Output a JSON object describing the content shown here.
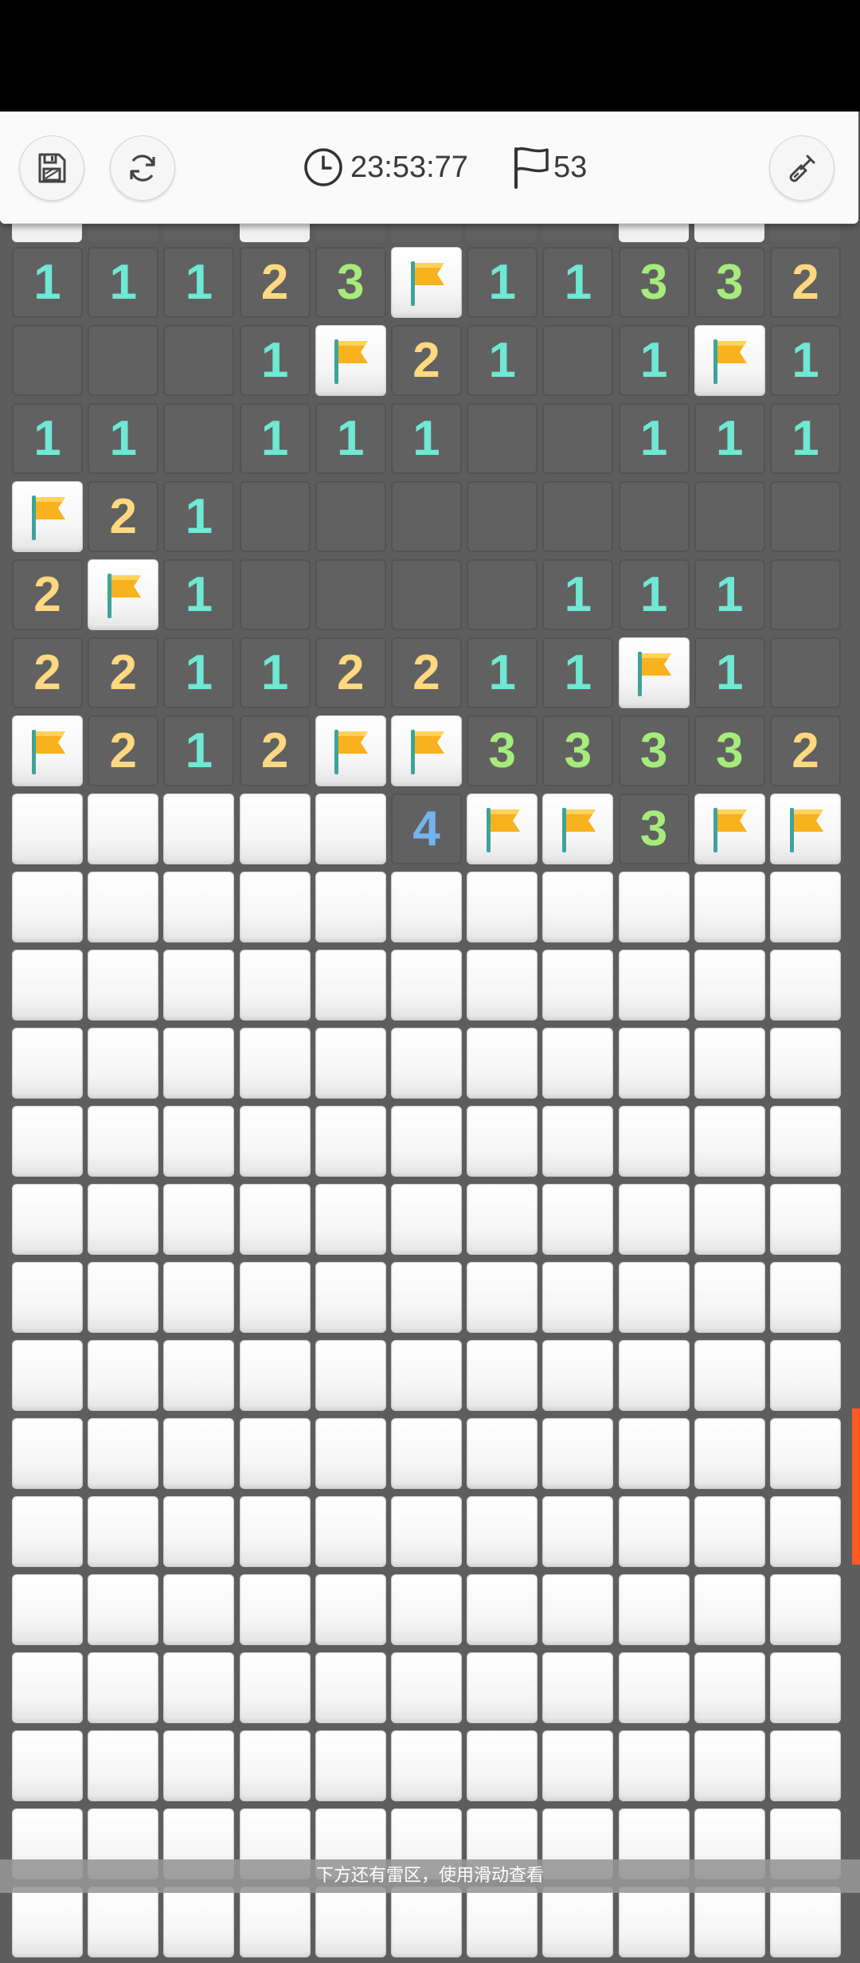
{
  "toolbar": {
    "timer": "23:53:77",
    "flags_remaining": "53",
    "icons": {
      "save": "save-icon",
      "restart": "refresh-icon",
      "timer": "clock-icon",
      "flags": "flag-outline-icon",
      "mode": "shovel-icon"
    }
  },
  "board": {
    "columns": 11,
    "legend": "digits = revealed count, F = flagged, . = revealed empty, # = covered",
    "rows": [
      [
        "1",
        "1",
        "1",
        "2",
        "3",
        "F",
        "1",
        "1",
        "3",
        "3",
        "2"
      ],
      [
        ".",
        ".",
        ".",
        "1",
        "F",
        "2",
        "1",
        ".",
        "1",
        "F",
        "1"
      ],
      [
        "1",
        "1",
        ".",
        "1",
        "1",
        "1",
        ".",
        ".",
        "1",
        "1",
        "1"
      ],
      [
        "F",
        "2",
        "1",
        ".",
        ".",
        ".",
        ".",
        ".",
        ".",
        ".",
        "."
      ],
      [
        "2",
        "F",
        "1",
        ".",
        ".",
        ".",
        ".",
        "1",
        "1",
        "1",
        "."
      ],
      [
        "2",
        "2",
        "1",
        "1",
        "2",
        "2",
        "1",
        "1",
        "F",
        "1",
        "."
      ],
      [
        "F",
        "2",
        "1",
        "2",
        "F",
        "F",
        "3",
        "3",
        "3",
        "3",
        "2"
      ],
      [
        "#",
        "#",
        "#",
        "#",
        "#",
        "4",
        "F",
        "F",
        "3",
        "F",
        "F"
      ],
      [
        "#",
        "#",
        "#",
        "#",
        "#",
        "#",
        "#",
        "#",
        "#",
        "#",
        "#"
      ],
      [
        "#",
        "#",
        "#",
        "#",
        "#",
        "#",
        "#",
        "#",
        "#",
        "#",
        "#"
      ],
      [
        "#",
        "#",
        "#",
        "#",
        "#",
        "#",
        "#",
        "#",
        "#",
        "#",
        "#"
      ],
      [
        "#",
        "#",
        "#",
        "#",
        "#",
        "#",
        "#",
        "#",
        "#",
        "#",
        "#"
      ],
      [
        "#",
        "#",
        "#",
        "#",
        "#",
        "#",
        "#",
        "#",
        "#",
        "#",
        "#"
      ],
      [
        "#",
        "#",
        "#",
        "#",
        "#",
        "#",
        "#",
        "#",
        "#",
        "#",
        "#"
      ],
      [
        "#",
        "#",
        "#",
        "#",
        "#",
        "#",
        "#",
        "#",
        "#",
        "#",
        "#"
      ],
      [
        "#",
        "#",
        "#",
        "#",
        "#",
        "#",
        "#",
        "#",
        "#",
        "#",
        "#"
      ],
      [
        "#",
        "#",
        "#",
        "#",
        "#",
        "#",
        "#",
        "#",
        "#",
        "#",
        "#"
      ],
      [
        "#",
        "#",
        "#",
        "#",
        "#",
        "#",
        "#",
        "#",
        "#",
        "#",
        "#"
      ],
      [
        "#",
        "#",
        "#",
        "#",
        "#",
        "#",
        "#",
        "#",
        "#",
        "#",
        "#"
      ],
      [
        "#",
        "#",
        "#",
        "#",
        "#",
        "#",
        "#",
        "#",
        "#",
        "#",
        "#"
      ],
      [
        "#",
        "#",
        "#",
        "#",
        "#",
        "#",
        "#",
        "#",
        "#",
        "#",
        "#"
      ],
      [
        "#",
        "#",
        "#",
        "#",
        "#",
        "#",
        "#",
        "#",
        "#",
        "#",
        "#"
      ]
    ],
    "peek_row": [
      "#",
      ".",
      ".",
      "#",
      ".",
      ".",
      ".",
      ".",
      "#",
      "#",
      "."
    ]
  },
  "colors": {
    "number_1": "#6fe8d4",
    "number_2": "#ffd880",
    "number_3": "#a6ec7a",
    "number_4": "#74b4ee",
    "flag": "#f7b21e",
    "scroll_indicator": "#ff5a1f"
  },
  "hint": "下方还有雷区，使用滑动查看"
}
